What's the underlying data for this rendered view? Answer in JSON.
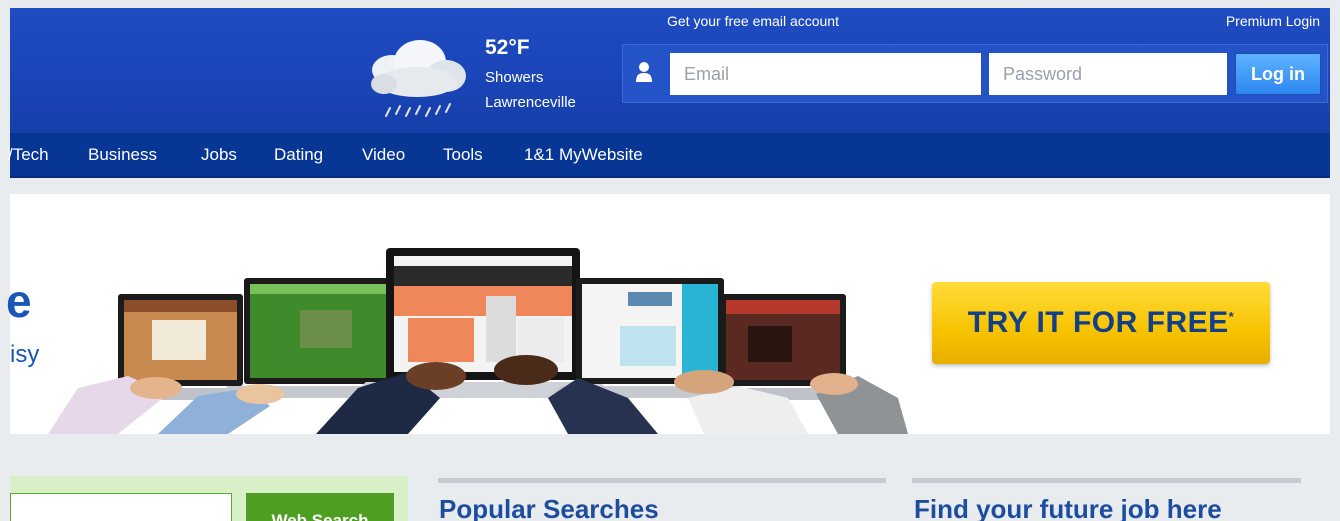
{
  "weather": {
    "temperature": "52°F",
    "condition": "Showers",
    "location": "Lawrenceville",
    "icon": "rain-cloud-icon"
  },
  "account": {
    "promo_link": "Get your free email account",
    "premium_link": "Premium Login",
    "email_placeholder": "Email",
    "password_placeholder": "Password",
    "login_label": "Log in",
    "user_icon": "user-icon"
  },
  "nav": {
    "items": [
      "/Tech",
      "Business",
      "Jobs",
      "Dating",
      "Video",
      "Tools",
      "1&1 MyWebsite"
    ]
  },
  "banner": {
    "headline_fragment": "e",
    "subline_fragment": "isy",
    "cta_label": "TRY IT FOR FREE",
    "cta_mark": "*"
  },
  "search": {
    "button_label": "Web Search"
  },
  "sections": {
    "popular_title": "Popular Searches",
    "jobs_title": "Find your future job here"
  },
  "colors": {
    "header_blue": "#1b45b8",
    "nav_blue": "#073695",
    "login_button": "#2d86f0",
    "cta_yellow": "#f7c300",
    "cta_text": "#123f86",
    "search_green": "#4e9e21",
    "heading_blue": "#1d4d9e"
  }
}
